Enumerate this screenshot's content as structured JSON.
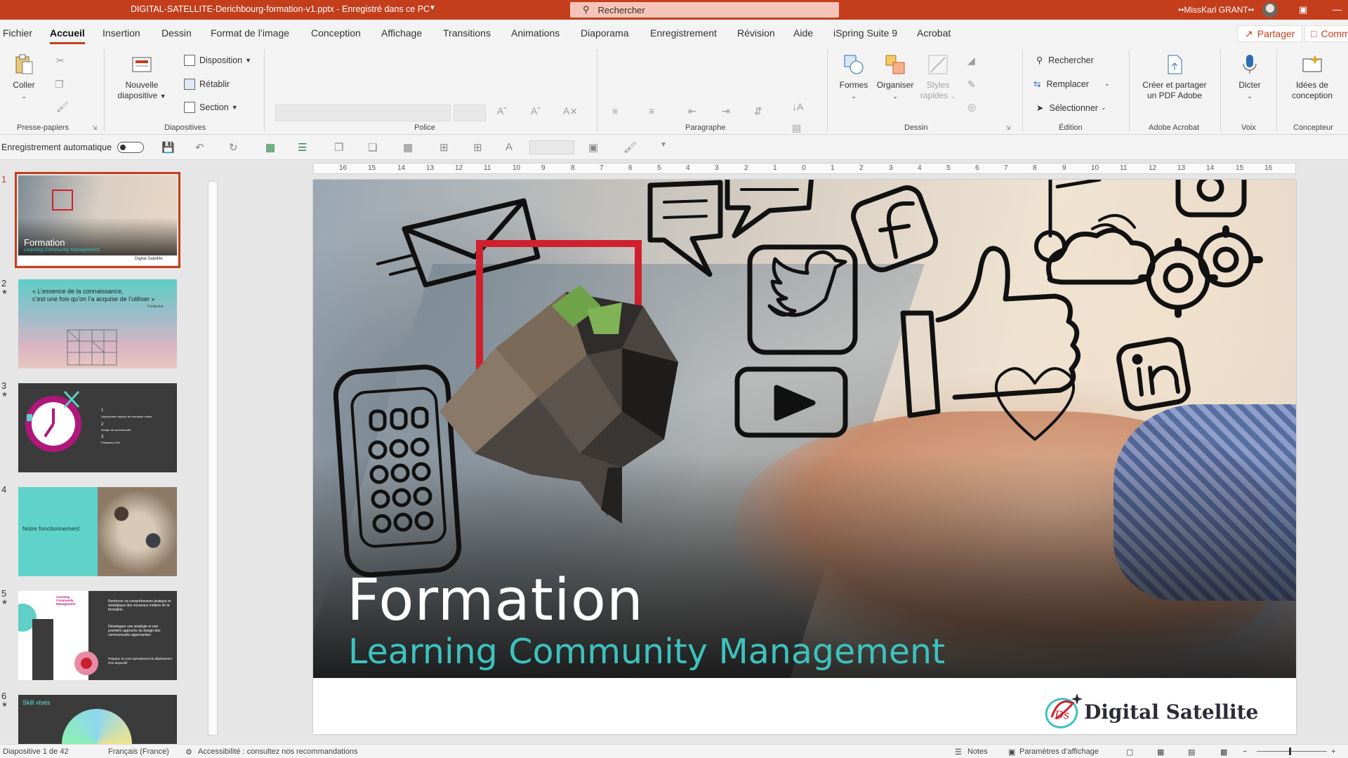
{
  "window": {
    "title": "DIGITAL-SATELLITE-Derichbourg-formation-v1.pptx  -  Enregistré dans ce PC",
    "search_placeholder": "Rechercher",
    "user_name": "••MissKarl GRANT••"
  },
  "menu": {
    "tabs": [
      "Fichier",
      "Accueil",
      "Insertion",
      "Dessin",
      "Format de l’image",
      "Conception",
      "Affichage",
      "Transitions",
      "Animations",
      "Diaporama",
      "Enregistrement",
      "Révision",
      "Aide",
      "iSpring Suite 9",
      "Acrobat"
    ],
    "active_tab": "Accueil",
    "share_label": "Partager",
    "comments_label": "Commentaires"
  },
  "ribbon": {
    "groups": {
      "clipboard": "Presse-papiers",
      "slides": "Diapositives",
      "font": "Police",
      "paragraph": "Paragraphe",
      "drawing": "Dessin",
      "editing": "Édition",
      "acrobat": "Adobe Acrobat",
      "voice": "Voix",
      "designer": "Concepteur"
    },
    "paste": "Coller",
    "new_slide_1": "Nouvelle",
    "new_slide_2": "diapositive",
    "layout": "Disposition",
    "reset": "Rétablir",
    "section": "Section",
    "shapes": "Formes",
    "arrange": "Organiser",
    "quick_styles_1": "Styles",
    "quick_styles_2": "rapides",
    "find": "Rechercher",
    "replace": "Remplacer",
    "select": "Sélectionner",
    "pdf_1": "Créer et partager",
    "pdf_2": "un PDF Adobe",
    "dictate": "Dicter",
    "ideas_1": "Idées de",
    "ideas_2": "conception"
  },
  "qat": {
    "autosave": "Enregistrement automatique"
  },
  "thumbnails": [
    {
      "num": "1",
      "title": "Formation",
      "subtitle": "Learning Community Management",
      "brand": "Digital Satellite"
    },
    {
      "num": "2",
      "quote_1": "« L’essence de la connaissance,",
      "quote_2": "c’est une fois qu’on l’a acquise de l’utiliser »",
      "author": "Confucius"
    },
    {
      "num": "3",
      "item1": "1",
      "item1_text": "Déploiement rassuré de formation online",
      "item2": "2",
      "item2_text": "Design de communauté",
      "item3": "3",
      "item3_text": "Pratiques LCM"
    },
    {
      "num": "4",
      "text": "Notre fonctionnement"
    },
    {
      "num": "5",
      "heading": "Learning Community Management",
      "b1": "Renforcer sa compréhension pratique et stratégique des nouveaux métiers de la formation",
      "b2": "Développer une stratégie et une première approche du design des communautés apprenantes",
      "b3": "Préparer la LCM opérationnel du déploiement d’un dispositif"
    },
    {
      "num": "6",
      "text": "Skill visés"
    }
  ],
  "ruler": {
    "labels": [
      "16",
      "15",
      "14",
      "13",
      "12",
      "11",
      "10",
      "9",
      "8",
      "7",
      "6",
      "5",
      "4",
      "3",
      "2",
      "1",
      "0",
      "1",
      "2",
      "3",
      "4",
      "5",
      "6",
      "7",
      "8",
      "9",
      "10",
      "11",
      "12",
      "13",
      "14",
      "15",
      "16"
    ]
  },
  "slide": {
    "title": "Formation",
    "subtitle": "Learning Community Management",
    "brand": "Digital Satellite",
    "colors": {
      "accent_red": "#d0202e",
      "teal": "#3cc3bf"
    }
  },
  "status": {
    "slide_info": "Diapositive 1 de 42",
    "language": "Français (France)",
    "accessibility": "Accessibilité : consultez nos recommandations",
    "notes": "Notes",
    "display_settings": "Paramètres d’affichage"
  }
}
